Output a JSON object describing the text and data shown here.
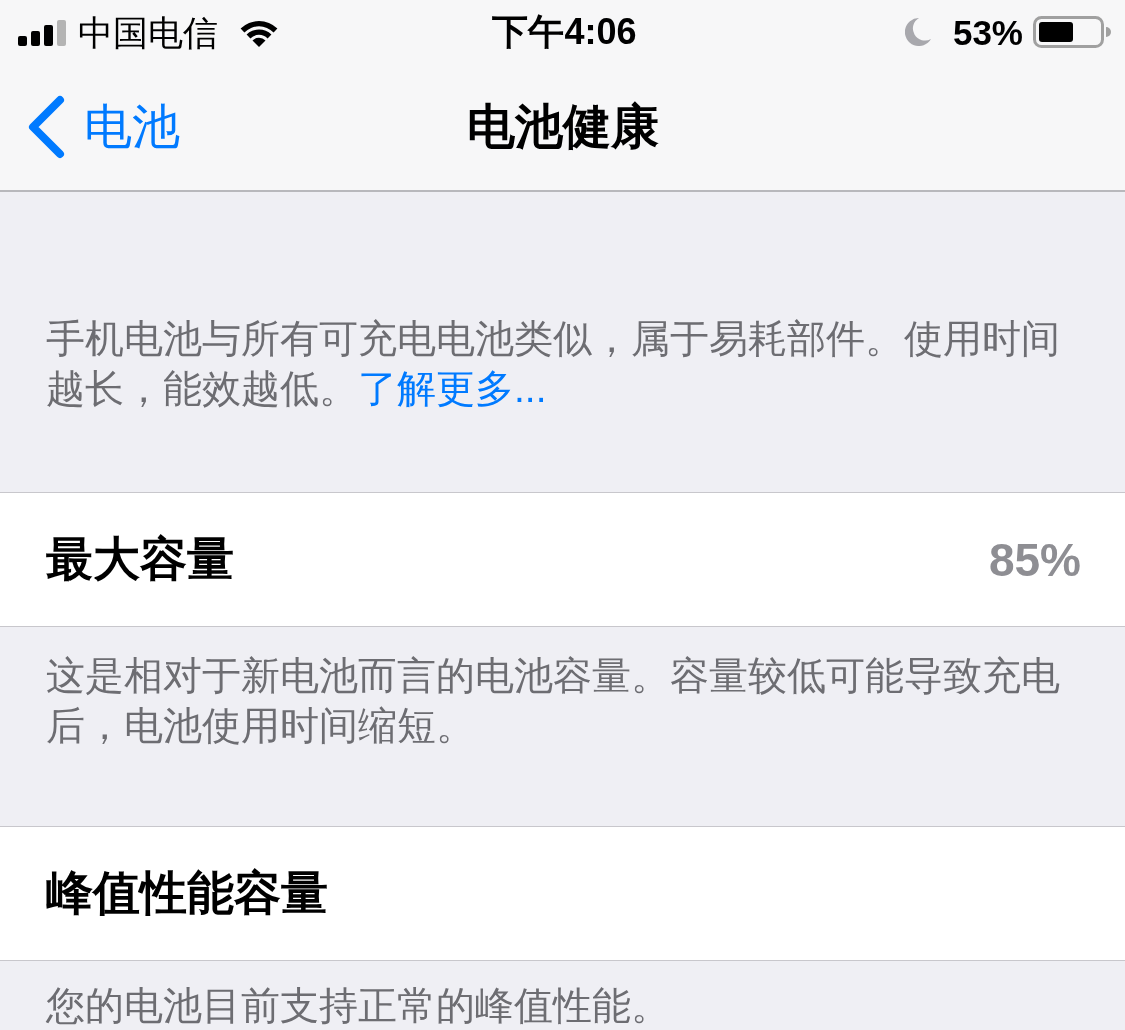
{
  "status_bar": {
    "carrier": "中国电信",
    "time": "下午4:06",
    "battery_percent": "53%"
  },
  "nav": {
    "back_label": "电池",
    "title": "电池健康"
  },
  "intro": {
    "text": "手机电池与所有可充电电池类似，属于易耗部件。使用时间越长，能效越低。",
    "link": "了解更多..."
  },
  "sections": [
    {
      "label": "最大容量",
      "value": "85%",
      "footer": "这是相对于新电池而言的电池容量。容量较低可能导致充电后，电池使用时间缩短。"
    },
    {
      "label": "峰值性能容量",
      "footer": "您的电池目前支持正常的峰值性能。"
    }
  ]
}
